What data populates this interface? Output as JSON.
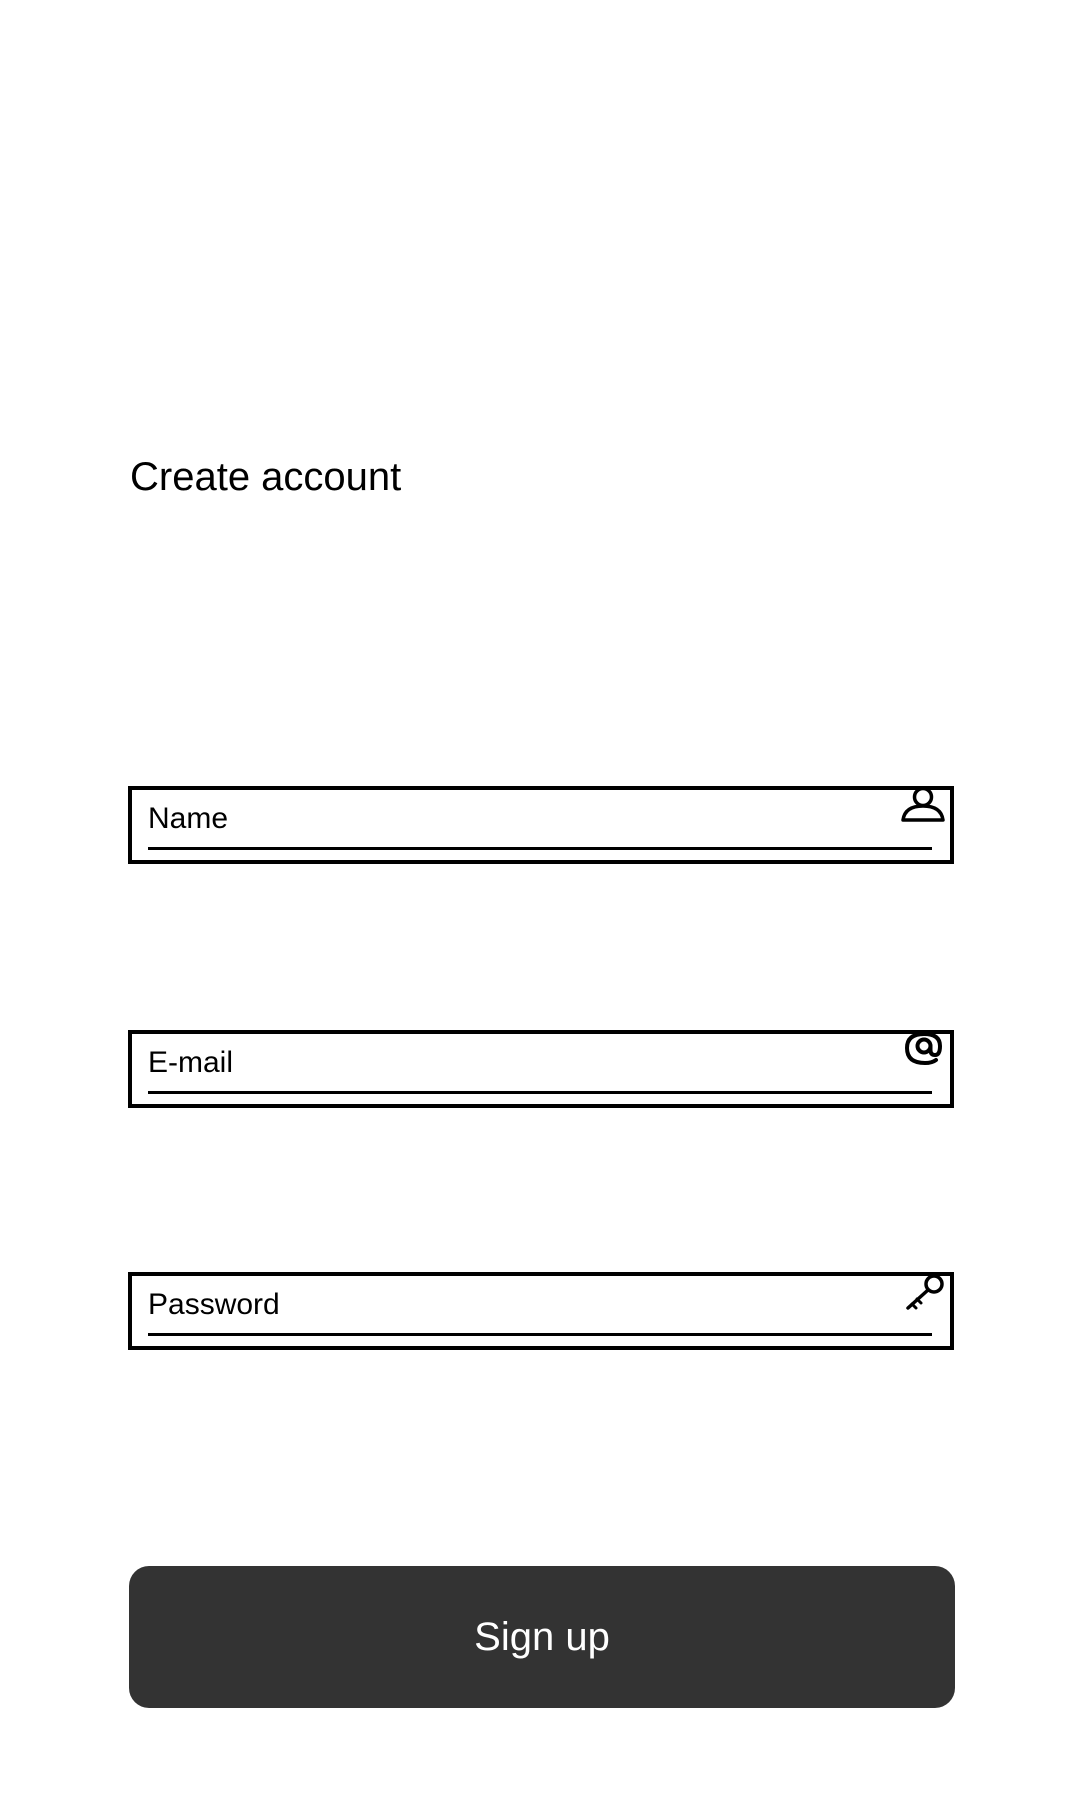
{
  "page": {
    "title": "Create account"
  },
  "form": {
    "name_placeholder": "Name",
    "email_placeholder": "E-mail",
    "password_placeholder": "Password"
  },
  "icons": {
    "name": "person-icon",
    "email": "at-sign-icon",
    "password": "key-icon"
  },
  "button": {
    "signup_label": "Sign up",
    "background": "#333333",
    "text_color": "#ffffff"
  }
}
